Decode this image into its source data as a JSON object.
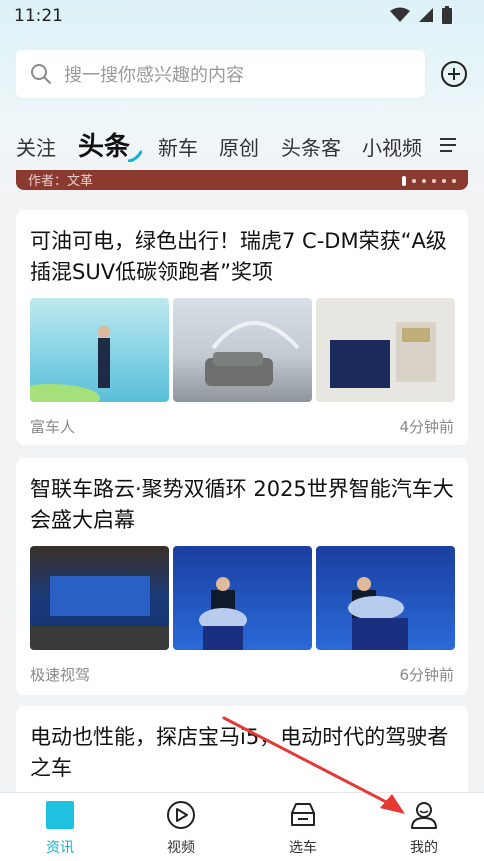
{
  "status_bar": {
    "time": "11:21"
  },
  "search": {
    "placeholder": "搜一搜你感兴趣的内容"
  },
  "tabs": [
    {
      "label": "关注"
    },
    {
      "label": "头条"
    },
    {
      "label": "新车"
    },
    {
      "label": "原创"
    },
    {
      "label": "头条客"
    },
    {
      "label": "小视频"
    }
  ],
  "banner": {
    "text": "作者：文革"
  },
  "articles": [
    {
      "title": "可油可电，绿色出行！瑞虎7 C-DM荣获“A级插混SUV低碳领跑者”奖项",
      "source": "富车人",
      "time": "4分钟前"
    },
    {
      "title": "智联车路云·聚势双循环 2025世界智能汽车大会盛大启幕",
      "source": "极速视驾",
      "time": "6分钟前"
    },
    {
      "title": "电动也性能，探店宝马i5，电动时代的驾驶者之车"
    }
  ],
  "bottom_nav": [
    {
      "label": "资讯"
    },
    {
      "label": "视频"
    },
    {
      "label": "选车"
    },
    {
      "label": "我的"
    }
  ],
  "colors": {
    "accent": "#17b1d0",
    "banner": "#8a3a2f",
    "arrow": "#e53935"
  }
}
